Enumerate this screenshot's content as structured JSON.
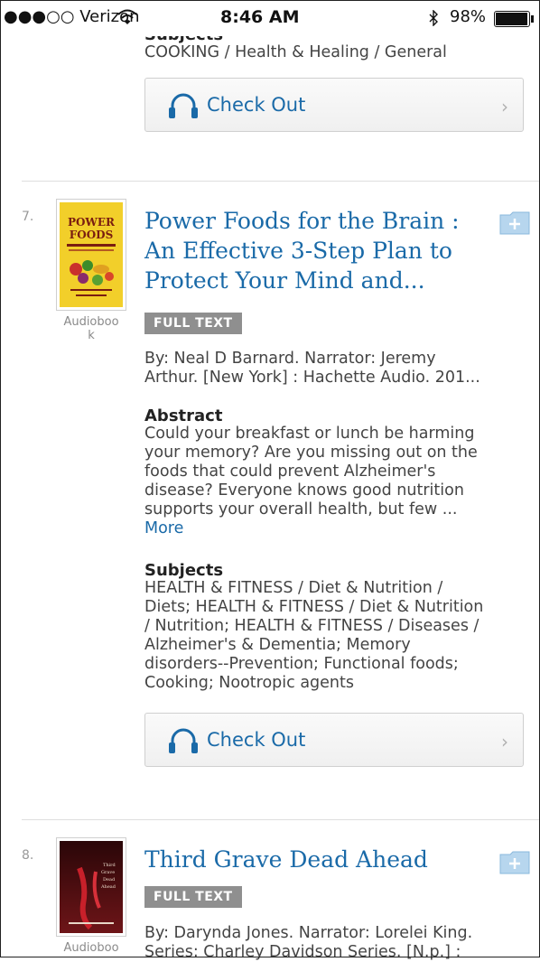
{
  "status_bar": {
    "carrier": "●●●○○ Verizon",
    "wifi_icon": "wifi-icon",
    "time": "8:46 AM",
    "bluetooth_icon": "bluetooth-icon",
    "battery": "98%",
    "battery_level": 0.98
  },
  "partial_record": {
    "subjects_heading": "Subjects",
    "subjects": "COOKING / Health & Healing / General",
    "checkout_label": "Check Out"
  },
  "results": [
    {
      "number": "7.",
      "format_line1": "Audioboo",
      "format_line2": "k",
      "title_line1": "Power Foods for the Brain :",
      "title_line2": "An Effective 3-Step Plan to",
      "title_line3": "Protect Your Mind and...",
      "badge": "FULL TEXT",
      "byline_line1": "By: Neal D Barnard. Narrator: Jeremy",
      "byline_line2": "Arthur. [New York] : Hachette Audio. 201...",
      "abstract_heading": "Abstract",
      "abstract_line1": "Could your breakfast or lunch be harming",
      "abstract_line2": "your memory? Are you missing out on the",
      "abstract_line3": "foods that could prevent Alzheimer's",
      "abstract_line4": "disease? Everyone knows good nutrition",
      "abstract_line5": "supports your overall health, but few ...",
      "more_label": "More",
      "subjects_heading": "Subjects",
      "subjects_line1": "HEALTH & FITNESS / Diet & Nutrition /",
      "subjects_line2": "Diets; HEALTH & FITNESS / Diet & Nutrition",
      "subjects_line3": "/ Nutrition; HEALTH & FITNESS / Diseases /",
      "subjects_line4": "Alzheimer's & Dementia; Memory",
      "subjects_line5": "disorders--Prevention; Functional foods;",
      "subjects_line6": "Cooking; Nootropic agents",
      "checkout_label": "Check Out",
      "cover_title": "POWER FOODS"
    },
    {
      "number": "8.",
      "format_line1": "Audioboo",
      "title_line1": "Third Grave Dead Ahead",
      "badge": "FULL TEXT",
      "byline_line1": "By: Darynda Jones. Narrator: Lorelei King.",
      "byline_line2": "Series: Charley Davidson Series. [N.p.] :"
    }
  ],
  "colors": {
    "link": "#1a6aa8",
    "badge_bg": "#8f8f8f",
    "cover7_bg": "#f2cf2a",
    "cover8_bg": "#4a0f12"
  }
}
